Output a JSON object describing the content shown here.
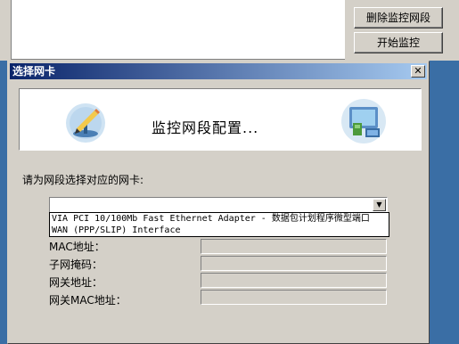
{
  "background_app": {
    "buttons": [
      {
        "label": "删除监控网段"
      },
      {
        "label": "开始监控"
      }
    ]
  },
  "dialog": {
    "title": "选择网卡",
    "close_glyph": "✕",
    "banner_text": "监控网段配置...",
    "banner_left_icon": "network-edit-icon",
    "banner_right_icon": "computer-network-icon",
    "prompt": "请为网段选择对应的网卡:",
    "adapter_select": {
      "value": "",
      "options": [
        "VIA PCI 10/100Mb Fast Ethernet Adapter - 数据包计划程序微型端口",
        "WAN (PPP/SLIP) Interface"
      ]
    },
    "fields": [
      {
        "label": "MAC地址：",
        "value": ""
      },
      {
        "label": "子网掩码：",
        "value": ""
      },
      {
        "label": "网关地址：",
        "value": ""
      },
      {
        "label": "网关MAC地址：",
        "value": ""
      }
    ]
  }
}
